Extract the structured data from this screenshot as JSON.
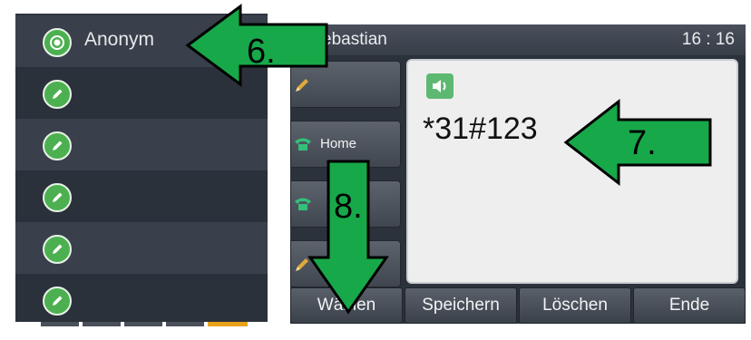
{
  "contact_list": {
    "rows": [
      {
        "label": "Anonym",
        "icon": "radio-selected-icon"
      },
      {
        "label": "",
        "icon": "edit-pencil-icon"
      },
      {
        "label": "",
        "icon": "edit-pencil-icon"
      },
      {
        "label": "",
        "icon": "edit-pencil-icon"
      },
      {
        "label": "",
        "icon": "edit-pencil-icon"
      },
      {
        "label": "",
        "icon": "edit-pencil-icon"
      }
    ]
  },
  "phone": {
    "status_bar": {
      "caller_name": "ebastian",
      "time": "16 : 16"
    },
    "line_keys": [
      {
        "label": "",
        "icon": "pencil-icon"
      },
      {
        "label": "Home",
        "icon": "phone-handset-icon"
      },
      {
        "label": "",
        "icon": "phone-handset-icon"
      },
      {
        "label": "",
        "icon": "pencil-icon"
      }
    ],
    "dial": {
      "number": "*31#123",
      "mode_icon": "speaker-icon"
    },
    "softkeys": [
      "Wählen",
      "Speichern",
      "Löschen",
      "Ende"
    ]
  },
  "annotations": [
    "6.",
    "7.",
    "8."
  ],
  "colors": {
    "accent_green": "#4cb050",
    "arrow_green": "#17a84a",
    "panel_dark": "#2f3540",
    "dial_bg": "#eeeeee"
  }
}
